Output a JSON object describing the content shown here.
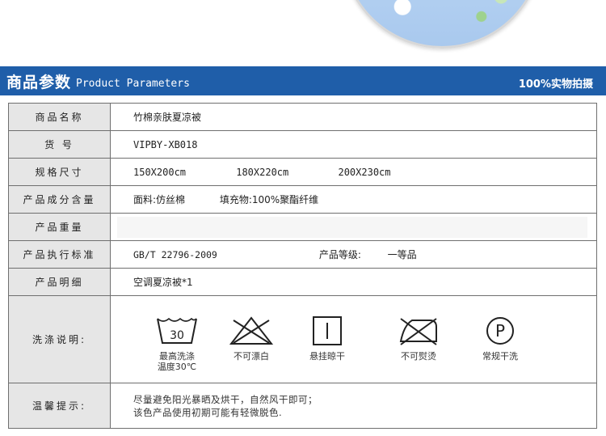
{
  "header": {
    "title_cn": "商品参数",
    "title_en": "Product Parameters",
    "badge": "100%实物拍摄"
  },
  "rows": {
    "name": {
      "label": "商品名称",
      "value": "竹棉亲肤夏凉被"
    },
    "sku": {
      "label": "货 号",
      "value": "VIPBY-XB018"
    },
    "size": {
      "label": "规格尺寸",
      "values": [
        "150X200cm",
        "180X220cm",
        "200X230cm"
      ]
    },
    "composition": {
      "label": "产品成分含量",
      "fabric": "面料:仿丝棉",
      "filling": "填充物:100%聚酯纤维"
    },
    "weight": {
      "label": "产品重量",
      "value": ""
    },
    "standard": {
      "label": "产品执行标准",
      "value": "GB/T 22796-2009",
      "grade_label": "产品等级:",
      "grade_value": "一等品"
    },
    "detail": {
      "label": "产品明细",
      "value": "空调夏凉被*1"
    },
    "wash": {
      "label": "洗涤说明:",
      "items": [
        {
          "icon": "washtub-30-icon",
          "tub_text": "30",
          "caption_1": "最高洗涤",
          "caption_2": "温度30℃"
        },
        {
          "icon": "no-bleach-icon",
          "caption_1": "不可漂白"
        },
        {
          "icon": "line-dry-icon",
          "caption_1": "悬挂晾干"
        },
        {
          "icon": "no-iron-icon",
          "caption_1": "不可熨烫"
        },
        {
          "icon": "dry-clean-p-icon",
          "p_text": "P",
          "caption_1": "常规干洗"
        }
      ]
    },
    "tip": {
      "label": "温馨提示:",
      "line_1": "尽量避免阳光暴晒及烘干，自然风干即可；",
      "line_2": "该色产品使用初期可能有轻微脱色."
    }
  }
}
